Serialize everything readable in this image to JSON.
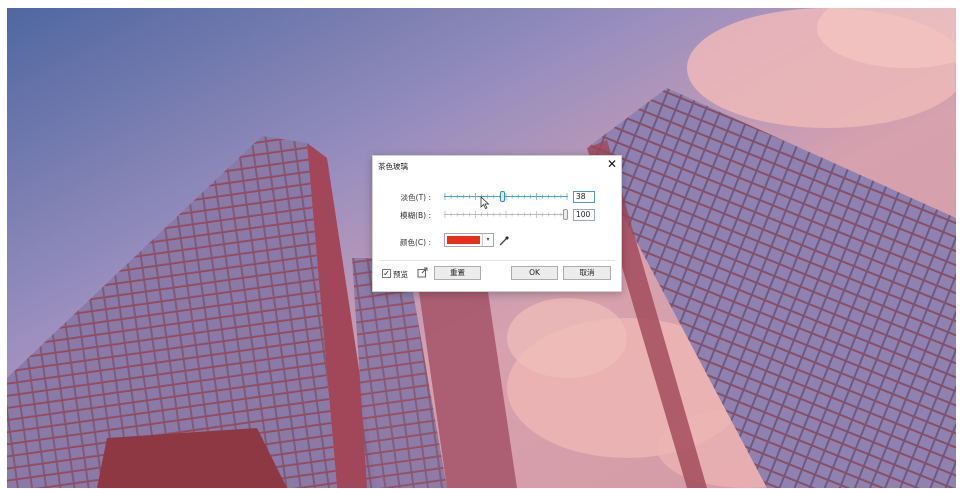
{
  "dialog": {
    "title": "茶色玻璃",
    "close_icon": "close-icon",
    "tint_label": "淡色(T) :",
    "tint_value": "38",
    "tint_fraction": 0.47,
    "blur_label": "模糊(B) :",
    "blur_value": "100",
    "blur_fraction": 1.0,
    "color_label": "颜色(C) :",
    "color_value": "#ee2d1f",
    "preview_label": "预览",
    "preview_checked": "✓",
    "reset_label": "重置",
    "ok_label": "OK",
    "cancel_label": "取消"
  },
  "colors": {
    "accent": "#4fa3d8",
    "dialog_bg": "#ffffff"
  }
}
